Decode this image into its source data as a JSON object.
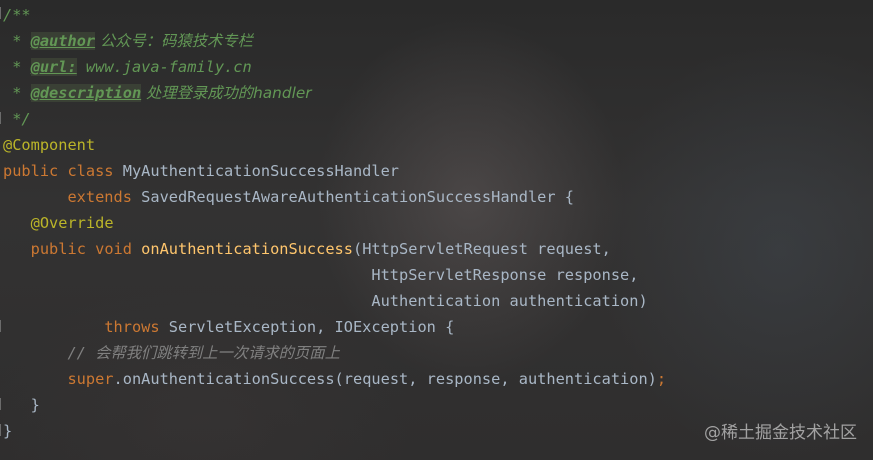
{
  "code": {
    "l1": "/**",
    "l2_star": " * ",
    "l2_tag": "@author",
    "l2_text": " 公众号：码猿技术专栏",
    "l3_star": " * ",
    "l3_tag": "@url:",
    "l3_text": " www.java-family.cn",
    "l4_star": " * ",
    "l4_tag": "@description",
    "l4_text": " 处理登录成功的handler",
    "l5": " */",
    "l6": "@Component",
    "l7_kw": "public class ",
    "l7_name": "MyAuthenticationSuccessHandler",
    "l8_indent": "       ",
    "l8_kw": "extends ",
    "l8_rest": "SavedRequestAwareAuthenticationSuccessHandler {",
    "l9_indent": "   ",
    "l9_ann": "@Override",
    "l10_indent": "   ",
    "l10_kw": "public void ",
    "l10_fn": "onAuthenticationSuccess",
    "l10_rest": "(HttpServletRequest request,",
    "l11": "                                        HttpServletResponse response,",
    "l12": "                                        Authentication authentication)",
    "l13_indent": "           ",
    "l13_kw": "throws ",
    "l13_rest": "ServletException, IOException {",
    "l14_indent": "       ",
    "l14_comment": "// ",
    "l14_cn": "会帮我们跳转到上一次请求的页面上",
    "l15_indent": "       ",
    "l15_kw": "super",
    "l15_rest": ".onAuthenticationSuccess(request, response, authentication)",
    "l15_semi": ";",
    "l16": "   }",
    "l17": "}"
  },
  "watermark": "@稀土掘金技术社区",
  "colors": {
    "keyword": "#cc7832",
    "annotation": "#bbb529",
    "method": "#ffc66d",
    "doc_comment": "#629755",
    "line_comment": "#808080",
    "text": "#a9b7c6"
  }
}
